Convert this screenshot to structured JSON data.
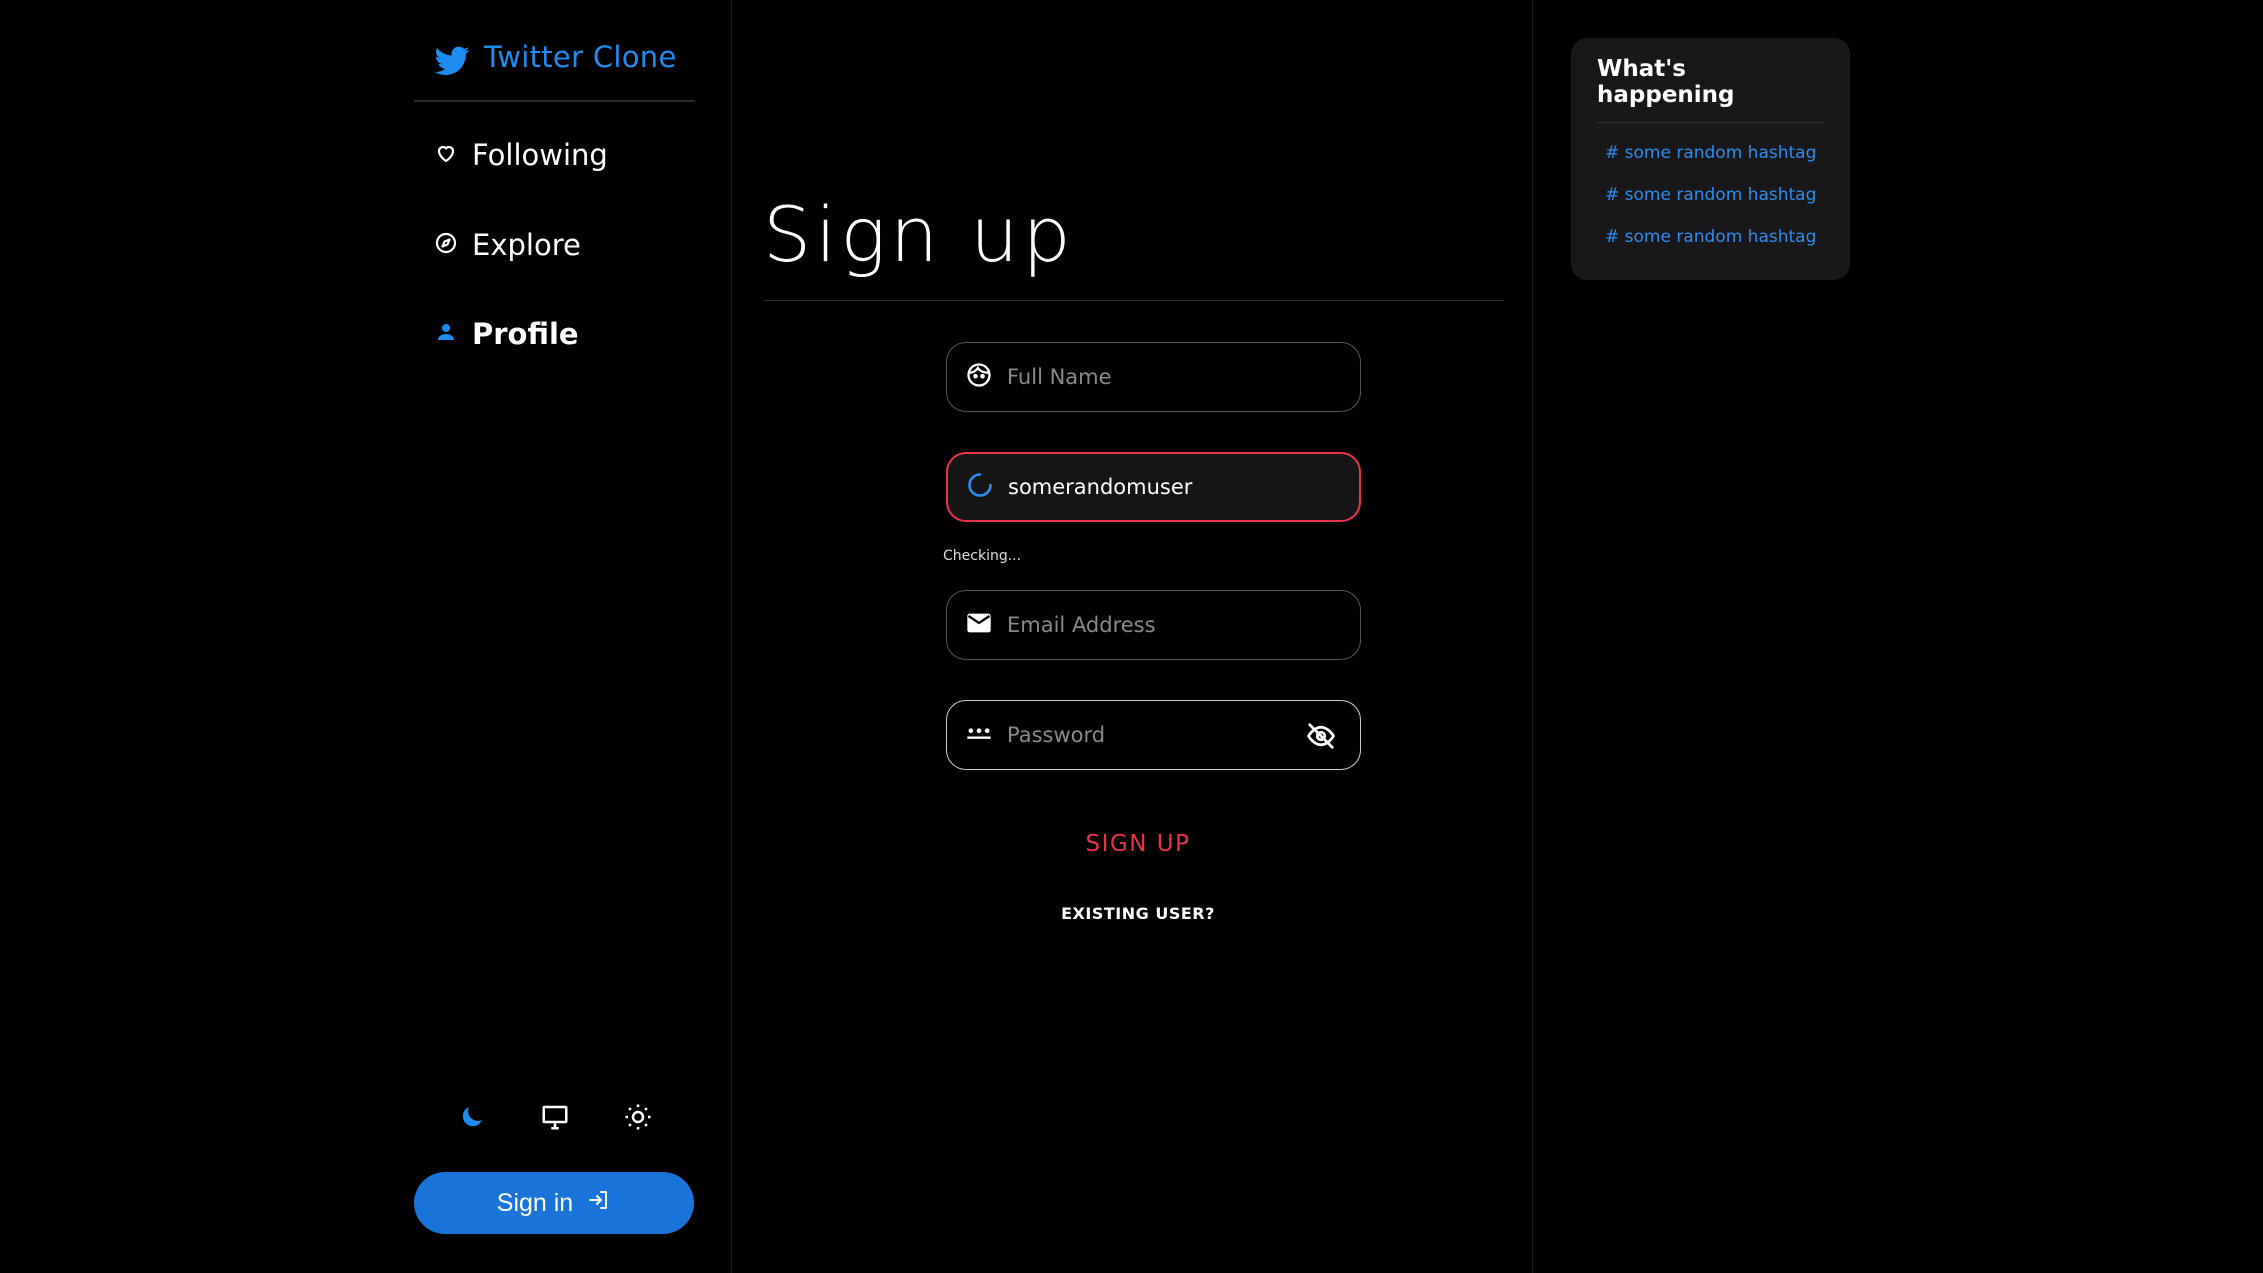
{
  "brand": {
    "title": "Twitter Clone"
  },
  "nav": {
    "following": "Following",
    "explore": "Explore",
    "profile": "Profile"
  },
  "theme": {
    "icons": [
      "moon-icon",
      "monitor-icon",
      "sun-icon"
    ],
    "active": "moon-icon"
  },
  "signin": {
    "label": "Sign in"
  },
  "main": {
    "title": "Sign up",
    "fields": {
      "fullname_placeholder": "Full Name",
      "username_value": "somerandomuser",
      "username_status": "Checking...",
      "email_placeholder": "Email Address",
      "password_placeholder": "Password"
    },
    "signup_label": "SIGN UP",
    "existing_label": "EXISTING USER?"
  },
  "trends": {
    "title": "What's happening",
    "items": [
      "# some random hashtag",
      "# some random hashtag",
      "# some random hashtag"
    ]
  },
  "colors": {
    "accent": "#1d8cf0",
    "danger": "#e8334a",
    "background": "#000000"
  }
}
